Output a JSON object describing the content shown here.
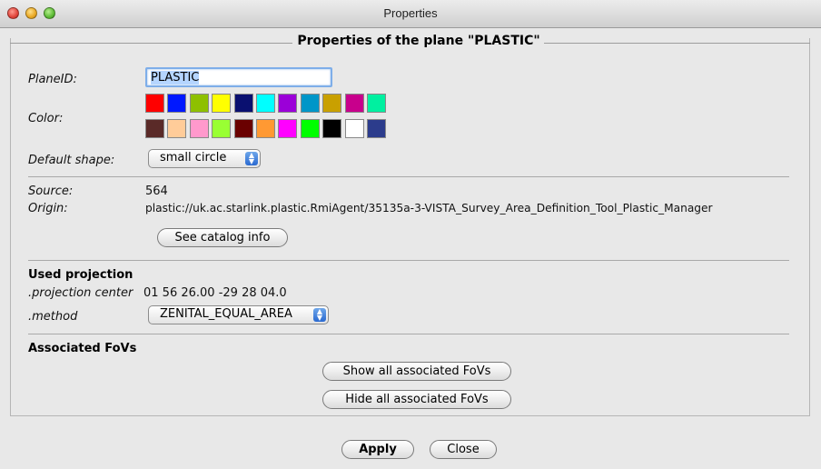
{
  "window": {
    "title": "Properties"
  },
  "panel": {
    "title": "Properties of the plane \"PLASTIC\""
  },
  "plane_id": {
    "label": "PlaneID:",
    "value": "PLASTIC"
  },
  "color": {
    "label": "Color:",
    "row1": [
      "#ff0000",
      "#0018ff",
      "#8ec000",
      "#ffff00",
      "#0a1070",
      "#00ffff",
      "#9b00d8",
      "#0096c8",
      "#c9a000",
      "#c8008c",
      "#00f0a0"
    ],
    "row2": [
      "#5a2a28",
      "#ffcc99",
      "#ff99cc",
      "#99ff33",
      "#6a0000",
      "#ff9933",
      "#ff00ff",
      "#00ff00",
      "#000000",
      "#ffffff",
      "#2c3c8c"
    ]
  },
  "default_shape": {
    "label": "Default shape:",
    "value": "small circle"
  },
  "source": {
    "label": "Source:",
    "value": "564"
  },
  "origin": {
    "label": "Origin:",
    "value": "plastic://uk.ac.starlink.plastic.RmiAgent/35135a-3-VISTA_Survey_Area_Definition_Tool_Plastic_Manager"
  },
  "see_catalog_button": "See catalog info",
  "projection": {
    "heading": "Used projection",
    "center_label": ".projection center",
    "center_value": "01 56 26.00 -29 28 04.0",
    "method_label": ".method",
    "method_value": "ZENITAL_EQUAL_AREA"
  },
  "fovs": {
    "heading": "Associated FoVs",
    "show_button": "Show all associated FoVs",
    "hide_button": "Hide all associated FoVs"
  },
  "footer": {
    "apply_button": "Apply",
    "close_button": "Close"
  }
}
